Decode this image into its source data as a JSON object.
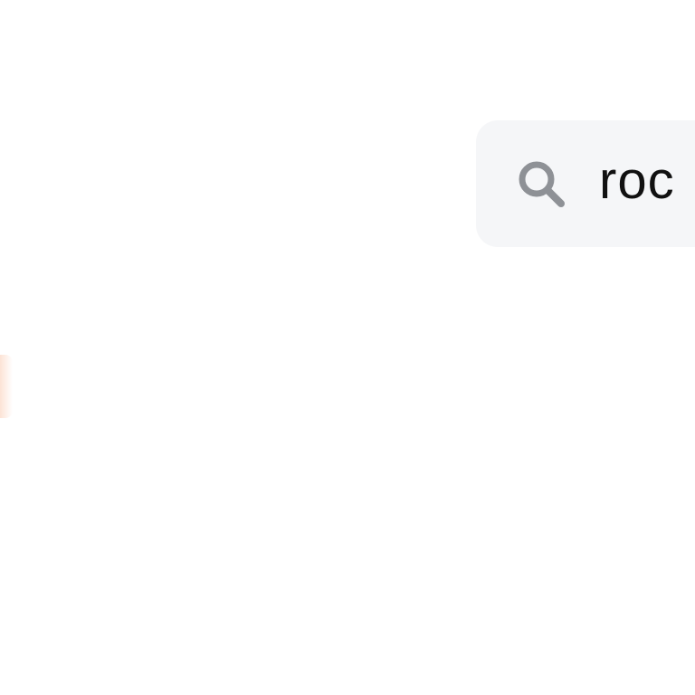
{
  "search": {
    "value": "roc",
    "icon": "search-icon"
  },
  "colors": {
    "search_background": "#f5f6f8",
    "search_icon": "#8e9196",
    "search_text": "#111111",
    "edge_accent": "#facdb4"
  }
}
